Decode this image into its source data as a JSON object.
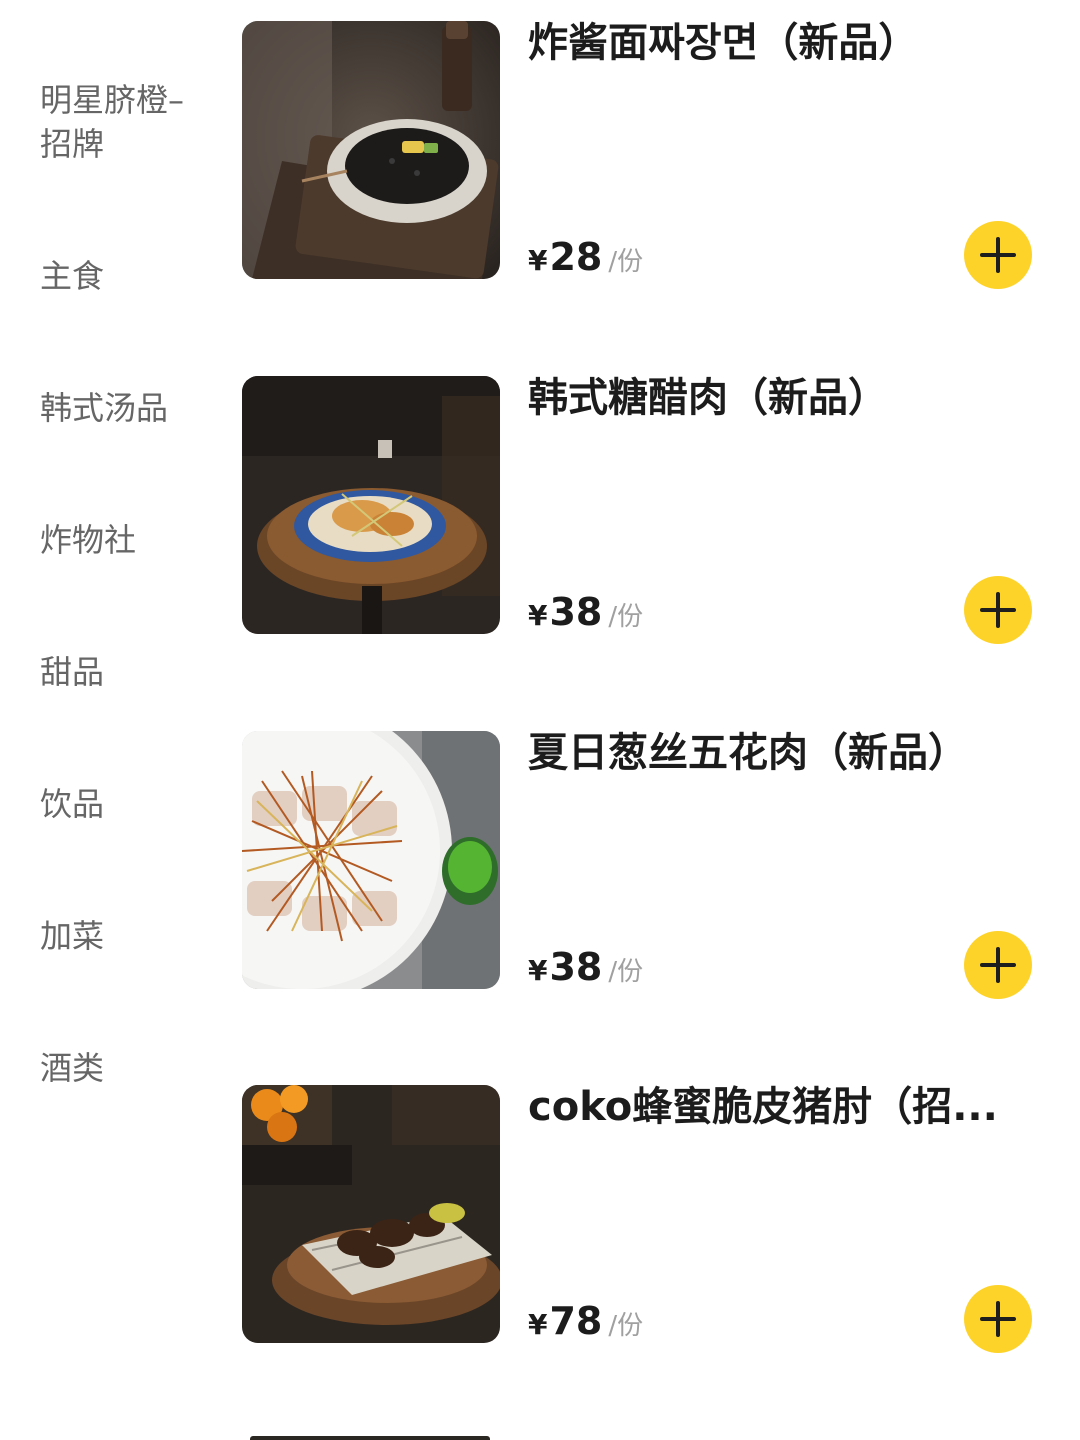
{
  "sidebar": {
    "categories": [
      {
        "label": "明星脐橙–招牌"
      },
      {
        "label": "主食"
      },
      {
        "label": "韩式汤品"
      },
      {
        "label": "炸物社"
      },
      {
        "label": "甜品"
      },
      {
        "label": "饮品"
      },
      {
        "label": "加菜"
      },
      {
        "label": "酒类"
      }
    ]
  },
  "dishes": [
    {
      "name": "炸酱面짜장면（新品）",
      "currency": "¥",
      "price": "28",
      "unit": "/份",
      "image_icon": "noodle-bowl-photo"
    },
    {
      "name": "韩式糖醋肉（新品）",
      "currency": "¥",
      "price": "38",
      "unit": "/份",
      "image_icon": "fried-pork-plate-photo"
    },
    {
      "name": "夏日葱丝五花肉（新品）",
      "currency": "¥",
      "price": "38",
      "unit": "/份",
      "image_icon": "pork-belly-plate-photo"
    },
    {
      "name": "coko蜂蜜脆皮猪肘（招...",
      "currency": "¥",
      "price": "78",
      "unit": "/份",
      "image_icon": "pork-knuckle-photo"
    }
  ],
  "colors": {
    "add_button": "#fdd32a",
    "category_text": "#666666",
    "price_unit": "#a0a0a0"
  }
}
